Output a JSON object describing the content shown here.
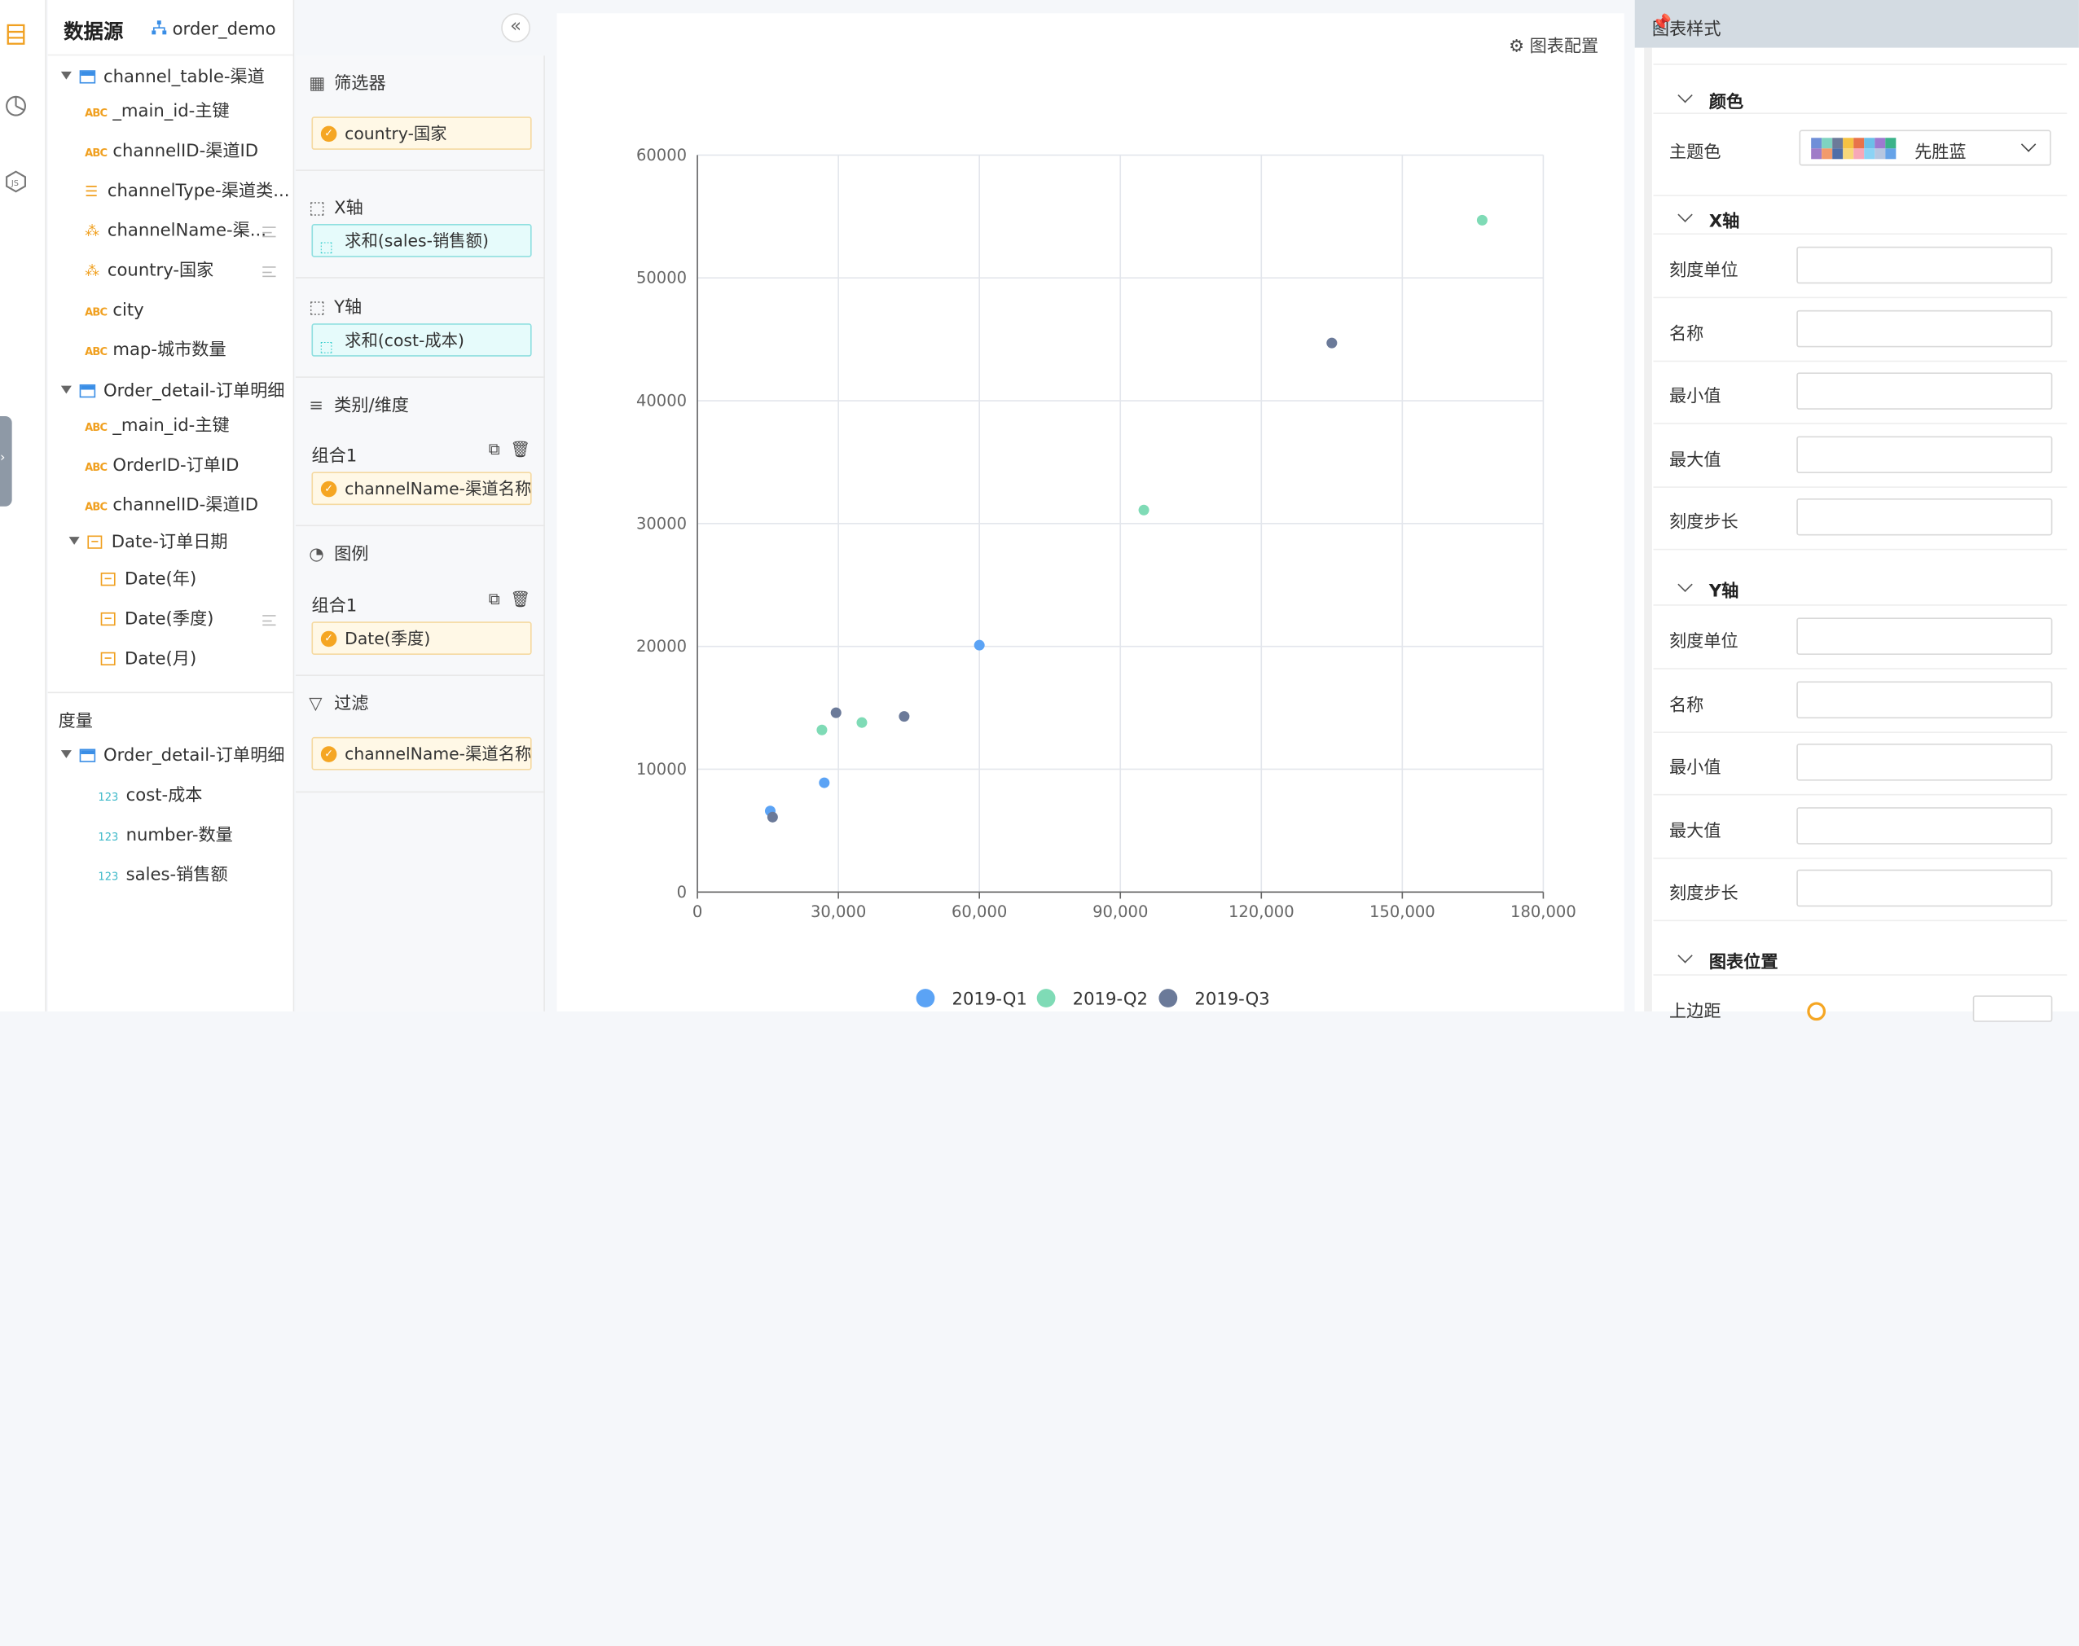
{
  "datasource": {
    "title": "数据源",
    "source_name": "order_demo",
    "dimension_tables": [
      {
        "name": "channel_table-渠道",
        "fields": [
          {
            "type": "abc",
            "label": "_main_id-主键"
          },
          {
            "type": "abc",
            "label": "channelID-渠道ID"
          },
          {
            "type": "list",
            "label": "channelType-渠道类..."
          },
          {
            "type": "net",
            "label": "channelName-渠...",
            "menu": true
          },
          {
            "type": "net",
            "label": "country-国家",
            "menu": true
          },
          {
            "type": "abc",
            "label": "city"
          },
          {
            "type": "abc",
            "label": "map-城市数量"
          }
        ]
      },
      {
        "name": "Order_detail-订单明细",
        "fields": [
          {
            "type": "abc",
            "label": "_main_id-主键"
          },
          {
            "type": "abc",
            "label": "OrderID-订单ID"
          },
          {
            "type": "abc",
            "label": "channelID-渠道ID"
          }
        ]
      }
    ],
    "date_group": {
      "label": "Date-订单日期",
      "children": [
        "Date(年)",
        "Date(季度)",
        "Date(月)"
      ]
    },
    "measures_title": "度量",
    "measure_table": {
      "name": "Order_detail-订单明细",
      "fields": [
        "cost-成本",
        "number-数量",
        "sales-销售额"
      ]
    }
  },
  "config": {
    "filter_title": "筛选器",
    "filter_value": "country-国家",
    "x_title": "X轴",
    "x_value": "求和(sales-销售额)",
    "y_title": "Y轴",
    "y_value": "求和(cost-成本)",
    "category_title": "类别/维度",
    "category_group": "组合1",
    "category_value": "channelName-渠道名称",
    "legend_title": "图例",
    "legend_group": "组合1",
    "legend_value": "Date(季度)",
    "filter2_title": "过滤",
    "filter2_value": "channelName-渠道名称"
  },
  "chart_config_label": "图表配置",
  "chart_data": {
    "type": "scatter",
    "title": "",
    "xlabel": "",
    "ylabel": "",
    "xlim": [
      0,
      180000
    ],
    "ylim": [
      0,
      60000
    ],
    "x_ticks": [
      "0",
      "30,000",
      "60,000",
      "90,000",
      "120,000",
      "150,000",
      "180,000"
    ],
    "y_ticks": [
      "0",
      "10000",
      "20000",
      "30000",
      "40000",
      "50000",
      "60000"
    ],
    "grid": true,
    "legend_position": "bottom",
    "series": [
      {
        "name": "2019-Q1",
        "color": "#5ba3f5",
        "points": [
          [
            15500,
            6600
          ],
          [
            27000,
            8900
          ],
          [
            60000,
            20100
          ]
        ]
      },
      {
        "name": "2019-Q2",
        "color": "#7fdbb6",
        "points": [
          [
            26500,
            13200
          ],
          [
            35000,
            13800
          ],
          [
            95000,
            31100
          ],
          [
            167000,
            54700
          ]
        ]
      },
      {
        "name": "2019-Q3",
        "color": "#6b7a99",
        "points": [
          [
            16000,
            6100
          ],
          [
            29500,
            14600
          ],
          [
            44000,
            14300
          ],
          [
            135000,
            44700
          ]
        ]
      }
    ]
  },
  "style_panel": {
    "title": "图表样式",
    "color_section": "颜色",
    "theme_label": "主题色",
    "theme_value": "先胜蓝",
    "swatch_colors": [
      "#6f8fd8",
      "#7fd3c0",
      "#6c7a99",
      "#f5c242",
      "#e8734a",
      "#6bbfe8",
      "#9d7ad0",
      "#3cb38a",
      "#a07cc8",
      "#f29a6b",
      "#4e6ea8",
      "#f7d87a",
      "#f7a8b8",
      "#8bd3f5",
      "#b6c6e0",
      "#66a3e8"
    ],
    "x_axis_section": "X轴",
    "y_axis_section": "Y轴",
    "axis_fields": [
      "刻度单位",
      "名称",
      "最小值",
      "最大值",
      "刻度步长"
    ],
    "position_section": "图表位置",
    "position_first_label": "上边距"
  }
}
